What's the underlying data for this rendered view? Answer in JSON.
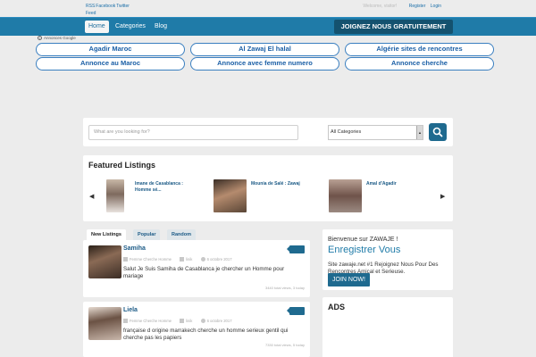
{
  "toplinks": [
    "RSS",
    "Facebook",
    "Twitter",
    "Feed"
  ],
  "userlinks": {
    "welcome": "Welcome, visitor!",
    "register": "Register",
    "login": "Login"
  },
  "nav": {
    "home": "Home",
    "categories": "Categories",
    "blog": "Blog",
    "join": "JOIGNEZ NOUS GRATUITEMENT"
  },
  "google_ads": {
    "label": "Annonces Google",
    "links": [
      "Agadir Maroc",
      "Al Zawaj El halal",
      "Algérie sites de rencontres",
      "Annonce au Maroc",
      "Annonce avec femme numero",
      "Annonce cherche"
    ]
  },
  "search": {
    "placeholder": "What are you looking for?",
    "category": "All Categories"
  },
  "featured": {
    "title": "Featured Listings",
    "items": [
      "Imane de Casablanca : Homme sé...",
      "Mounia de Salé : Zawaj",
      "Amal d'Agadir"
    ]
  },
  "tabs": [
    "New Listings",
    "Popular",
    "Random"
  ],
  "listings": [
    {
      "title": "Samiha",
      "category": "Femme Cherche Homme",
      "author": "linik",
      "date": "6 octobre 2017",
      "desc": "Salut Je Suis Samiha de Casablanca je chercher un Homme pour mariage",
      "views": "3440 total views, 3 today"
    },
    {
      "title": "Liela",
      "category": "Femme Cherche Homme",
      "author": "linik",
      "date": "6 octobre 2017",
      "desc": "française d origine marrakech cherche un homme serieux gentil qui cherche pas les papiers",
      "views": "7330 total views, 5 today"
    }
  ],
  "sidebar": {
    "welcome": "Bienvenue sur ZAWAJE !",
    "register_title": "Enregistrer Vous",
    "text": "Site zawaje.net #1 Rejoignez Nous Pour Des Rencontres Amical et Serieuse.",
    "join": "JOIN NOW!",
    "ads_title": "ADS"
  },
  "colors": {
    "primary": "#1f7ba8",
    "dark": "#14526f",
    "link": "#1b5a86"
  }
}
